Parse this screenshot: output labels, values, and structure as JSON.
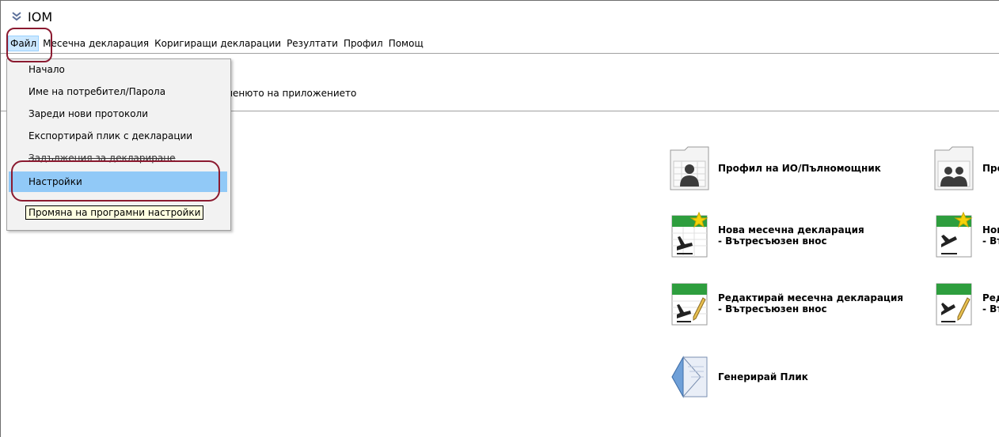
{
  "window": {
    "title": "IOM",
    "app_icon": "down-double-chevron-icon"
  },
  "menubar": {
    "items": [
      "Файл",
      "Месечна декларация",
      "Коригиращи декларации",
      "Резултати",
      "Профил",
      "Помощ"
    ]
  },
  "hint_text": "менюто на приложението",
  "file_menu": {
    "items": [
      "Начало",
      "Име на потребител/Парола",
      "Зареди нови протоколи",
      "Експортирай плик с декларации",
      "Задължения за деклариране",
      "Настройки"
    ],
    "highlighted": "Настройки",
    "tooltip": "Промяна на програмни настройки"
  },
  "actions": [
    {
      "line1": "Профил на ИО/Пълномощник",
      "line2": "",
      "icon": "profile-single-icon"
    },
    {
      "line1": "Про",
      "line2": "",
      "icon": "profile-group-icon"
    },
    {
      "line1": "Нова месечна декларация",
      "line2": "- Вътресъюзен внос",
      "icon": "new-declaration-import-icon"
    },
    {
      "line1": "Нов",
      "line2": "- Вт",
      "icon": "new-declaration-export-icon"
    },
    {
      "line1": "Редактирай месечна декларация",
      "line2": "- Вътресъюзен внос",
      "icon": "edit-declaration-import-icon"
    },
    {
      "line1": "Ред",
      "line2": "- Вт",
      "icon": "edit-declaration-export-icon"
    },
    {
      "line1": "Генерирай Плик",
      "line2": "",
      "icon": "envelope-icon"
    }
  ],
  "colors": {
    "menu_highlight": "#91c9f7",
    "annotation": "#8b1a30",
    "tooltip_bg": "#ffffe1",
    "icon_green": "#2e9e3e"
  }
}
